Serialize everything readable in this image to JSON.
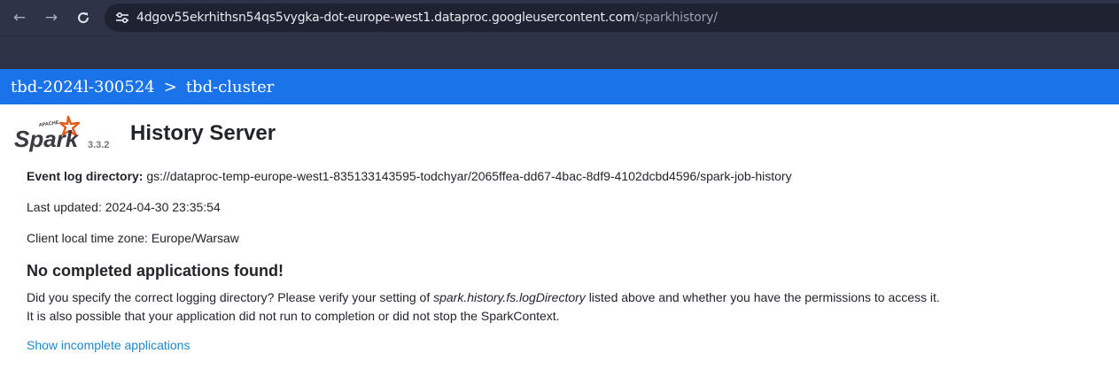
{
  "browser": {
    "url_host": "4dgov55ekrhithsn54qs5vygka-dot-europe-west1.dataproc.googleusercontent.com",
    "url_path": "/sparkhistory/",
    "icons": [
      "back-arrow-icon",
      "forward-arrow-icon",
      "reload-icon",
      "site-settings-icon"
    ]
  },
  "cluster_header": {
    "project": "tbd-2024l-300524",
    "separator": ">",
    "cluster": "tbd-cluster",
    "color": "#1a73e8"
  },
  "spark": {
    "logo_label": "Spark",
    "logo_apache": "APACHE",
    "version": "3.3.2",
    "title": "History Server"
  },
  "info": {
    "event_log_label": "Event log directory:",
    "event_log_value": "gs://dataproc-temp-europe-west1-835133143595-todchyar/2065ffea-dd67-4bac-8df9-4102dcbd4596/spark-job-history",
    "last_updated_label": "Last updated:",
    "last_updated_value": "2024-04-30 23:35:54",
    "timezone_label": "Client local time zone:",
    "timezone_value": "Europe/Warsaw"
  },
  "empty": {
    "title": "No completed applications found!",
    "line1_pre": "Did you specify the correct logging directory? Please verify your setting of",
    "line1_setting": "spark.history.fs.logDirectory",
    "line1_post": "listed above and whether you have the permissions to access it.",
    "line2": "It is also possible that your application did not run to completion or did not stop the SparkContext.",
    "link": "Show incomplete applications"
  }
}
